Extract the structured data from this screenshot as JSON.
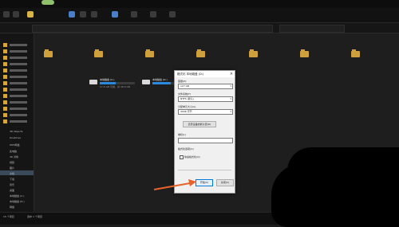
{
  "explorer": {
    "nav_items": [
      "3D Objects",
      "OneDrive",
      "WPS网盘",
      "此电脑",
      "3D 对象",
      "视频",
      "图片",
      "文档",
      "下载",
      "音乐",
      "桌面",
      "本地磁盘 (C:)",
      "本地磁盘 (D:)",
      "网络"
    ],
    "drives": [
      {
        "name": "本地磁盘 (C:)",
        "free": "27.6 GB 可用，共 48.0 GB",
        "used_fraction": 0.45
      },
      {
        "name": "本地磁盘 (D:)",
        "free": "",
        "used_fraction": 0.6
      }
    ],
    "status_left": "15 个项目",
    "status_sel": "选中 1 个项目",
    "tray_text": "中 英 拼"
  },
  "dialog": {
    "title": "格式化 本地磁盘 (D:)",
    "capacity_label": "容量(P):",
    "capacity_value": "127 GB",
    "fs_label": "文件系统(F)",
    "fs_value": "NTFS (默认)",
    "alloc_label": "分配单元大小(A)",
    "alloc_value": "4096 字节",
    "restore_btn": "还原设备的默认值(D)",
    "volume_label": "卷标(L)",
    "volume_value": "",
    "options_label": "格式化选项(O)",
    "quick_label": "快速格式化(Q)",
    "start_btn": "开始(S)",
    "close_btn": "关闭(C)",
    "close_glyph": "×",
    "accent": "#0078d7"
  },
  "annotation": {
    "arrow_color": "#e8632a"
  }
}
